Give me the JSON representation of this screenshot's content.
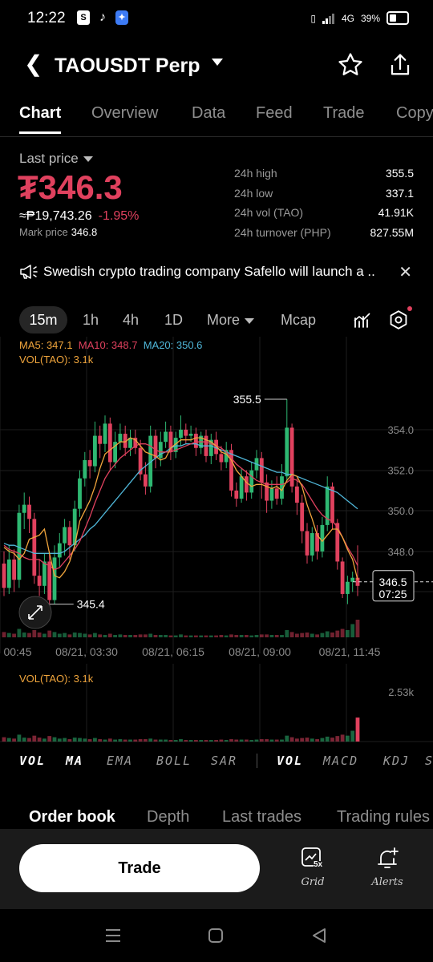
{
  "status_bar": {
    "time": "12:22",
    "network": "4G",
    "battery": "39%"
  },
  "header": {
    "title": "TAOUSDT Perp",
    "back_icon": "back-chevron-icon",
    "favorite_icon": "star-outline-icon",
    "share_icon": "share-icon"
  },
  "tabs": [
    "Chart",
    "Overview",
    "Data",
    "Feed",
    "Trade",
    "Copy"
  ],
  "price": {
    "label": "Last price",
    "last": "₮346.3",
    "php_equiv": "≈₱19,743.26",
    "change": "-1.95%",
    "mark_label": "Mark price",
    "mark_value": "346.8",
    "color_down": "#e0415e"
  },
  "stats": [
    {
      "label": "24h high",
      "value": "355.5"
    },
    {
      "label": "24h low",
      "value": "337.1"
    },
    {
      "label": "24h vol (TAO)",
      "value": "41.91K"
    },
    {
      "label": "24h turnover (PHP)",
      "value": "827.55M"
    }
  ],
  "news": {
    "text": "Swedish crypto trading company Safello will launch a ..",
    "icon": "megaphone-icon",
    "close_icon": "close-icon"
  },
  "timeframes": {
    "items": [
      "15m",
      "1h",
      "4h",
      "1D",
      "More",
      "Mcap"
    ],
    "active": "15m"
  },
  "legend": {
    "ma5": "MA5: 347.1",
    "ma10": "MA10: 348.7",
    "ma20": "MA20: 350.6",
    "vol": "VOL(TAO): 3.1k",
    "ma5_color": "#f0a53c",
    "ma10_color": "#e0415e",
    "ma20_color": "#4fb6d8"
  },
  "chart_data": {
    "type": "candlestick",
    "y_ticks": [
      "354.0",
      "352.0",
      "350.0",
      "348.0"
    ],
    "x_ticks": [
      "00:45",
      "08/21, 03:30",
      "08/21, 06:15",
      "08/21, 09:00",
      "08/21, 11:45"
    ],
    "high_marker": "355.5",
    "low_marker": "345.4",
    "current_price": "346.5",
    "countdown": "07:25",
    "ylim": [
      344.6,
      355.5
    ],
    "candles": [
      {
        "o": 347.4,
        "c": 346.2,
        "h": 348.0,
        "l": 345.8
      },
      {
        "o": 346.2,
        "c": 347.6,
        "h": 348.3,
        "l": 345.9
      },
      {
        "o": 347.6,
        "c": 346.6,
        "h": 348.1,
        "l": 346.0
      },
      {
        "o": 346.6,
        "c": 349.9,
        "h": 350.3,
        "l": 346.2
      },
      {
        "o": 349.9,
        "c": 350.3,
        "h": 350.9,
        "l": 349.1
      },
      {
        "o": 350.3,
        "c": 349.6,
        "h": 350.7,
        "l": 348.9
      },
      {
        "o": 349.6,
        "c": 346.8,
        "h": 349.9,
        "l": 346.4
      },
      {
        "o": 346.8,
        "c": 346.3,
        "h": 347.6,
        "l": 345.8
      },
      {
        "o": 346.3,
        "c": 347.5,
        "h": 347.9,
        "l": 345.9
      },
      {
        "o": 347.5,
        "c": 345.6,
        "h": 347.9,
        "l": 345.2
      },
      {
        "o": 345.6,
        "c": 347.7,
        "h": 348.3,
        "l": 345.4
      },
      {
        "o": 347.7,
        "c": 348.4,
        "h": 348.9,
        "l": 347.2
      },
      {
        "o": 348.4,
        "c": 349.2,
        "h": 349.6,
        "l": 347.8
      },
      {
        "o": 349.2,
        "c": 348.3,
        "h": 349.5,
        "l": 347.6
      },
      {
        "o": 348.3,
        "c": 350.1,
        "h": 350.5,
        "l": 348.0
      },
      {
        "o": 350.1,
        "c": 351.6,
        "h": 352.0,
        "l": 349.7
      },
      {
        "o": 351.6,
        "c": 352.5,
        "h": 352.9,
        "l": 351.2
      },
      {
        "o": 352.5,
        "c": 352.2,
        "h": 353.0,
        "l": 351.6
      },
      {
        "o": 352.2,
        "c": 353.7,
        "h": 354.4,
        "l": 351.9
      },
      {
        "o": 353.7,
        "c": 353.3,
        "h": 354.2,
        "l": 352.6
      },
      {
        "o": 353.3,
        "c": 354.3,
        "h": 354.7,
        "l": 352.9
      },
      {
        "o": 354.3,
        "c": 352.4,
        "h": 354.6,
        "l": 352.0
      },
      {
        "o": 352.4,
        "c": 353.4,
        "h": 353.9,
        "l": 352.1
      },
      {
        "o": 353.4,
        "c": 353.8,
        "h": 354.3,
        "l": 353.0
      },
      {
        "o": 353.8,
        "c": 353.1,
        "h": 354.2,
        "l": 352.7
      },
      {
        "o": 353.1,
        "c": 353.6,
        "h": 354.0,
        "l": 352.7
      },
      {
        "o": 353.6,
        "c": 353.1,
        "h": 354.0,
        "l": 352.8
      },
      {
        "o": 353.1,
        "c": 351.8,
        "h": 353.5,
        "l": 351.5
      },
      {
        "o": 351.8,
        "c": 351.2,
        "h": 352.4,
        "l": 350.8
      },
      {
        "o": 351.2,
        "c": 353.7,
        "h": 354.2,
        "l": 350.9
      },
      {
        "o": 353.7,
        "c": 352.6,
        "h": 354.0,
        "l": 352.1
      },
      {
        "o": 352.6,
        "c": 353.4,
        "h": 353.9,
        "l": 352.2
      },
      {
        "o": 353.4,
        "c": 353.9,
        "h": 354.4,
        "l": 353.1
      },
      {
        "o": 353.9,
        "c": 352.9,
        "h": 354.2,
        "l": 352.5
      },
      {
        "o": 352.9,
        "c": 353.6,
        "h": 353.9,
        "l": 352.6
      },
      {
        "o": 353.6,
        "c": 354.0,
        "h": 354.7,
        "l": 353.2
      },
      {
        "o": 354.0,
        "c": 353.7,
        "h": 354.3,
        "l": 353.3
      },
      {
        "o": 353.7,
        "c": 353.8,
        "h": 354.2,
        "l": 353.4
      },
      {
        "o": 353.8,
        "c": 353.1,
        "h": 354.1,
        "l": 352.7
      },
      {
        "o": 353.1,
        "c": 353.7,
        "h": 353.9,
        "l": 352.8
      },
      {
        "o": 353.7,
        "c": 352.7,
        "h": 354.0,
        "l": 352.4
      },
      {
        "o": 352.7,
        "c": 353.5,
        "h": 353.8,
        "l": 352.3
      },
      {
        "o": 353.5,
        "c": 352.8,
        "h": 353.9,
        "l": 352.5
      },
      {
        "o": 352.8,
        "c": 352.4,
        "h": 353.2,
        "l": 352.0
      },
      {
        "o": 352.4,
        "c": 353.0,
        "h": 353.4,
        "l": 352.1
      },
      {
        "o": 353.0,
        "c": 351.0,
        "h": 353.3,
        "l": 350.7
      },
      {
        "o": 351.0,
        "c": 350.6,
        "h": 351.4,
        "l": 350.2
      },
      {
        "o": 350.6,
        "c": 351.7,
        "h": 352.1,
        "l": 350.4
      },
      {
        "o": 351.7,
        "c": 350.9,
        "h": 352.0,
        "l": 350.5
      },
      {
        "o": 350.9,
        "c": 352.0,
        "h": 352.4,
        "l": 350.6
      },
      {
        "o": 352.0,
        "c": 352.6,
        "h": 353.0,
        "l": 351.6
      },
      {
        "o": 352.6,
        "c": 351.4,
        "h": 352.9,
        "l": 350.6
      },
      {
        "o": 351.4,
        "c": 350.5,
        "h": 351.8,
        "l": 349.9
      },
      {
        "o": 350.5,
        "c": 351.1,
        "h": 351.5,
        "l": 350.1
      },
      {
        "o": 351.1,
        "c": 350.6,
        "h": 351.7,
        "l": 350.3
      },
      {
        "o": 350.6,
        "c": 351.7,
        "h": 352.3,
        "l": 350.3
      },
      {
        "o": 351.7,
        "c": 354.1,
        "h": 355.5,
        "l": 351.4
      },
      {
        "o": 354.1,
        "c": 351.2,
        "h": 354.3,
        "l": 350.9
      },
      {
        "o": 351.2,
        "c": 350.4,
        "h": 351.6,
        "l": 349.8
      },
      {
        "o": 350.4,
        "c": 349.0,
        "h": 350.8,
        "l": 348.4
      },
      {
        "o": 349.0,
        "c": 347.8,
        "h": 349.4,
        "l": 347.4
      },
      {
        "o": 347.8,
        "c": 348.9,
        "h": 349.2,
        "l": 347.5
      },
      {
        "o": 348.9,
        "c": 348.0,
        "h": 349.3,
        "l": 347.6
      },
      {
        "o": 348.0,
        "c": 349.3,
        "h": 349.7,
        "l": 347.7
      },
      {
        "o": 349.3,
        "c": 351.2,
        "h": 351.7,
        "l": 349.0
      },
      {
        "o": 351.2,
        "c": 349.4,
        "h": 351.4,
        "l": 349.1
      },
      {
        "o": 349.4,
        "c": 347.5,
        "h": 349.6,
        "l": 347.1
      },
      {
        "o": 347.5,
        "c": 345.9,
        "h": 347.7,
        "l": 345.7
      },
      {
        "o": 345.9,
        "c": 346.5,
        "h": 346.8,
        "l": 345.4
      },
      {
        "o": 346.5,
        "c": 346.7,
        "h": 347.0,
        "l": 346.0
      },
      {
        "o": 346.7,
        "c": 346.3,
        "h": 348.3,
        "l": 345.8
      }
    ],
    "ma5": [
      348.2,
      348.0,
      347.9,
      347.6,
      347.9,
      348.6,
      348.7,
      348.8,
      349.1,
      347.9,
      346.8,
      346.7,
      347.0,
      347.5,
      348.3,
      349.5,
      350.0,
      350.5,
      351.2,
      352.1,
      352.8,
      353.0,
      353.2,
      353.4,
      353.4,
      353.6,
      353.5,
      353.2,
      352.9,
      352.8,
      352.7,
      352.5,
      352.6,
      353.1,
      353.3,
      353.5,
      353.5,
      353.5,
      353.6,
      353.6,
      353.5,
      353.4,
      353.2,
      352.9,
      352.8,
      352.5,
      352.0,
      351.7,
      351.4,
      351.2,
      351.3,
      351.3,
      351.2,
      351.1,
      351.2,
      351.0,
      351.5,
      351.8,
      351.7,
      351.2,
      350.3,
      349.6,
      348.8,
      348.5,
      348.8,
      349.1,
      349.1,
      348.7,
      348.1,
      347.6,
      346.6
    ],
    "ma10": [
      348.3,
      348.1,
      348.0,
      347.9,
      347.7,
      347.6,
      347.6,
      347.6,
      347.4,
      347.3,
      347.1,
      347.2,
      347.5,
      347.8,
      348.1,
      348.5,
      349.1,
      349.7,
      350.4,
      351.0,
      351.6,
      352.0,
      352.3,
      352.6,
      352.8,
      353.0,
      353.2,
      353.3,
      353.3,
      353.2,
      353.0,
      352.9,
      352.9,
      352.9,
      353.0,
      353.1,
      353.2,
      353.3,
      353.4,
      353.4,
      353.4,
      353.3,
      353.2,
      353.1,
      352.9,
      352.6,
      352.3,
      352.1,
      351.9,
      351.7,
      351.5,
      351.4,
      351.3,
      351.3,
      351.3,
      351.3,
      351.4,
      351.6,
      351.5,
      351.3,
      350.9,
      350.5,
      350.1,
      349.8,
      349.6,
      349.5,
      349.2,
      348.7,
      348.2,
      347.8,
      347.3
    ],
    "ma20": [
      348.4,
      348.3,
      348.3,
      348.2,
      348.1,
      348.0,
      347.9,
      347.9,
      347.9,
      347.9,
      347.9,
      347.9,
      348.0,
      348.2,
      348.4,
      348.6,
      348.8,
      349.1,
      349.3,
      349.6,
      349.9,
      350.2,
      350.5,
      350.8,
      351.1,
      351.4,
      351.7,
      352.0,
      352.2,
      352.4,
      352.6,
      352.8,
      352.9,
      353.1,
      353.2,
      353.2,
      353.3,
      353.3,
      353.3,
      353.2,
      353.2,
      353.2,
      353.1,
      353.0,
      352.9,
      352.8,
      352.7,
      352.6,
      352.5,
      352.4,
      352.3,
      352.2,
      352.1,
      352.0,
      351.9,
      351.9,
      351.8,
      351.8,
      351.7,
      351.6,
      351.5,
      351.4,
      351.3,
      351.2,
      351.1,
      351.0,
      350.9,
      350.7,
      350.5,
      350.3,
      350.1
    ],
    "volume_tick": "2.53k",
    "volumes": [
      0.22,
      0.18,
      0.15,
      0.35,
      0.2,
      0.18,
      0.3,
      0.2,
      0.15,
      0.28,
      0.22,
      0.15,
      0.18,
      0.12,
      0.2,
      0.18,
      0.15,
      0.12,
      0.18,
      0.12,
      0.1,
      0.15,
      0.1,
      0.12,
      0.1,
      0.1,
      0.1,
      0.12,
      0.12,
      0.15,
      0.1,
      0.1,
      0.1,
      0.08,
      0.08,
      0.12,
      0.08,
      0.08,
      0.08,
      0.08,
      0.08,
      0.08,
      0.08,
      0.1,
      0.08,
      0.12,
      0.1,
      0.1,
      0.1,
      0.08,
      0.1,
      0.12,
      0.12,
      0.1,
      0.1,
      0.1,
      0.3,
      0.22,
      0.15,
      0.18,
      0.2,
      0.15,
      0.12,
      0.18,
      0.25,
      0.2,
      0.28,
      0.35,
      0.3,
      0.55,
      1.22
    ]
  },
  "indicators": [
    {
      "label": "VOL",
      "on": true
    },
    {
      "label": "MA",
      "on": true
    },
    {
      "label": "EMA",
      "on": false
    },
    {
      "label": "BOLL",
      "on": false
    },
    {
      "label": "SAR",
      "on": false
    },
    {
      "label": "VOL",
      "on": true
    },
    {
      "label": "MACD",
      "on": false
    },
    {
      "label": "KDJ",
      "on": false
    },
    {
      "label": "S",
      "on": false
    }
  ],
  "bottom_tabs": [
    "Order book",
    "Depth",
    "Last trades",
    "Trading rules"
  ],
  "actions": {
    "trade": "Trade",
    "grid": "Grid",
    "grid_badge": "5x",
    "alerts": "Alerts"
  },
  "colors": {
    "up": "#2eb872",
    "down": "#e0415e",
    "ma5": "#f0a53c",
    "ma10": "#e0415e",
    "ma20": "#4fb6d8"
  }
}
